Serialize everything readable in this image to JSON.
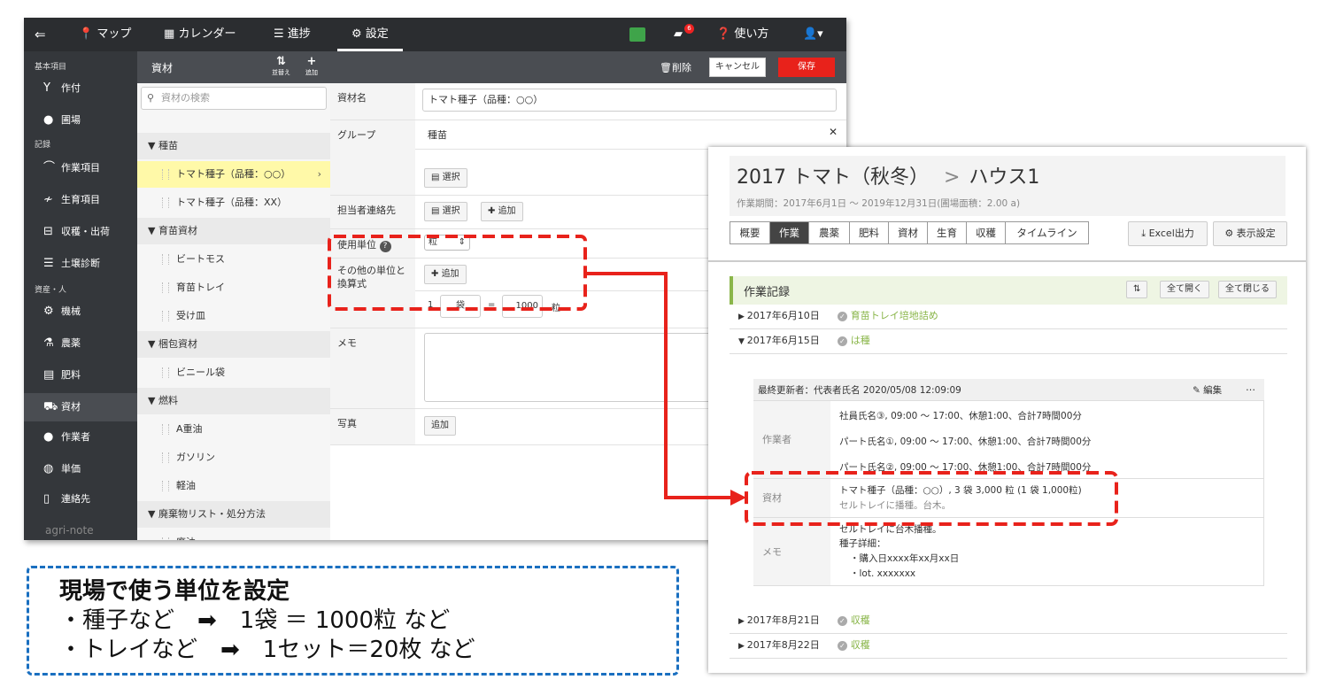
{
  "nav": {
    "items": [
      "マップ",
      "カレンダー",
      "進捗",
      "設定"
    ],
    "notification_count": "6",
    "help": "使い方"
  },
  "sidebar": {
    "sections": [
      {
        "title": "基本項目",
        "items": [
          "作付",
          "圃場"
        ]
      },
      {
        "title": "記録",
        "items": [
          "作業項目",
          "生育項目",
          "収穫・出荷",
          "土壌診断"
        ]
      },
      {
        "title": "資産・人",
        "items": [
          "機械",
          "農薬",
          "肥料",
          "資材",
          "作業者",
          "単価",
          "連絡先"
        ]
      }
    ],
    "logo": "agri-note"
  },
  "list": {
    "title": "資材",
    "sort_label": "並替え",
    "add_label": "追加",
    "search_placeholder": "資材の検索",
    "rows": [
      {
        "type": "group",
        "label": "▼ 種苗"
      },
      {
        "type": "item",
        "label": "トマト種子（品種：○○）",
        "selected": true
      },
      {
        "type": "item",
        "label": "トマト種子（品種：XX）"
      },
      {
        "type": "group",
        "label": "▼ 育苗資材"
      },
      {
        "type": "item",
        "label": "ビートモス"
      },
      {
        "type": "item",
        "label": "育苗トレイ"
      },
      {
        "type": "item",
        "label": "受け皿"
      },
      {
        "type": "group",
        "label": "▼ 梱包資材"
      },
      {
        "type": "item",
        "label": "ビニール袋"
      },
      {
        "type": "group",
        "label": "▼ 燃料"
      },
      {
        "type": "item",
        "label": "A重油"
      },
      {
        "type": "item",
        "label": "ガソリン"
      },
      {
        "type": "item",
        "label": "軽油"
      },
      {
        "type": "group",
        "label": "▼ 廃棄物リスト・処分方法"
      },
      {
        "type": "item",
        "label": "廃油"
      }
    ]
  },
  "form": {
    "delete_label": "削除",
    "cancel_label": "キャンセル",
    "save_label": "保存",
    "name_label": "資材名",
    "name_value": "トマト種子（品種：○○）",
    "group_label": "グループ",
    "group_value": "種苗",
    "select_label": "選択",
    "contact_label": "担当者連絡先",
    "add_label": "追加",
    "unit_label": "使用単位",
    "unit_value": "粒",
    "other_unit_label_1": "その他の単位と",
    "other_unit_label_2": "換算式",
    "conv_qty": "1",
    "conv_unit": "袋",
    "conv_eq": "=",
    "conv_value": "1000",
    "conv_base": "粒",
    "memo_label": "メモ",
    "photo_label": "写真",
    "photo_add": "追加"
  },
  "detail": {
    "title": "2017 トマト（秋冬）",
    "title_sep": ">",
    "field": "ハウス1",
    "period": "作業期間：2017年6月1日 〜 2019年12月31日(圃場面積：2.00 a)",
    "tabs": [
      "概要",
      "作業",
      "農薬",
      "肥料",
      "資材",
      "生育",
      "収穫",
      "タイムライン"
    ],
    "excel": "Excel出力",
    "display": "表示設定",
    "section_title": "作業記録",
    "open_all": "全て開く",
    "close_all": "全て閉じる",
    "records": [
      {
        "date": "2017年6月10日",
        "task": "育苗トレイ培地詰め",
        "open": false
      },
      {
        "date": "2017年6月15日",
        "task": "は種",
        "open": true
      },
      {
        "date": "2017年8月21日",
        "task": "収穫",
        "open": false
      },
      {
        "date": "2017年8月22日",
        "task": "収穫",
        "open": false
      }
    ],
    "card": {
      "updater": "最終更新者：代表者氏名 2020/05/08 12:09:09",
      "edit": "編集",
      "more": "…",
      "workers_label": "作業者",
      "workers": [
        "社員氏名③, 09:00 〜 17:00、休憩1:00、合計7時間00分",
        "パート氏名①, 09:00 〜 17:00、休憩1:00、合計7時間00分",
        "パート氏名②, 09:00 〜 17:00、休憩1:00、合計7時間00分"
      ],
      "material_label": "資材",
      "material_line": "トマト種子（品種：○○）, 3 袋 3,000 粒 (1 袋 1,000粒)",
      "material_note": "セルトレイに播種。台木。",
      "memo_label": "メモ",
      "memo_lines": [
        "セルトレイに台木播種。",
        "種子詳細：",
        "・購入日xxxx年xx月xx日",
        "・lot. xxxxxxx"
      ]
    }
  },
  "callout": {
    "line1": "現場で使う単位を設定",
    "line2": "・種子など　➡　1袋 ＝ 1000粒 など",
    "line3": "・トレイなど　➡　1セット＝20枚 など"
  },
  "colors": {
    "nav_bg": "#2b2d30",
    "save": "#e8221b",
    "highlight": "#e8221b",
    "callout_border": "#1a6fc0",
    "ok_green": "#8ab64a",
    "selected_row": "#fff9a8"
  }
}
